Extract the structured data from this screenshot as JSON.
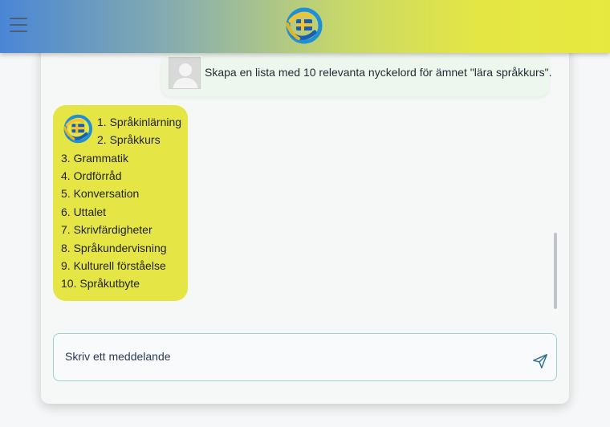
{
  "header": {
    "menu_icon": "hamburger-menu-icon",
    "logo_icon": "app-logo-icon",
    "colors": {
      "gradient_start": "#4a86d6",
      "gradient_end": "#e7e83f"
    }
  },
  "chat": {
    "user_message": {
      "avatar_icon": "user-avatar-icon",
      "text": "Skapa en lista med 10 relevanta nyckelord för ämnet \"lära språkkurs\"."
    },
    "bot_message": {
      "logo_icon": "bot-logo-icon",
      "bubble_color": "#e5e645",
      "lines": [
        "1. Språkinlärning",
        "2. Språkkurs",
        "3. Grammatik",
        "4. Ordförråd",
        "5. Konversation",
        "6. Uttalet",
        "7. Skrivfärdigheter",
        "8. Språkundervisning",
        "9. Kulturell förståelse",
        "10. Språkutbyte"
      ]
    }
  },
  "composer": {
    "placeholder": "Skriv ett meddelande",
    "value": "",
    "send_icon": "send-icon"
  }
}
